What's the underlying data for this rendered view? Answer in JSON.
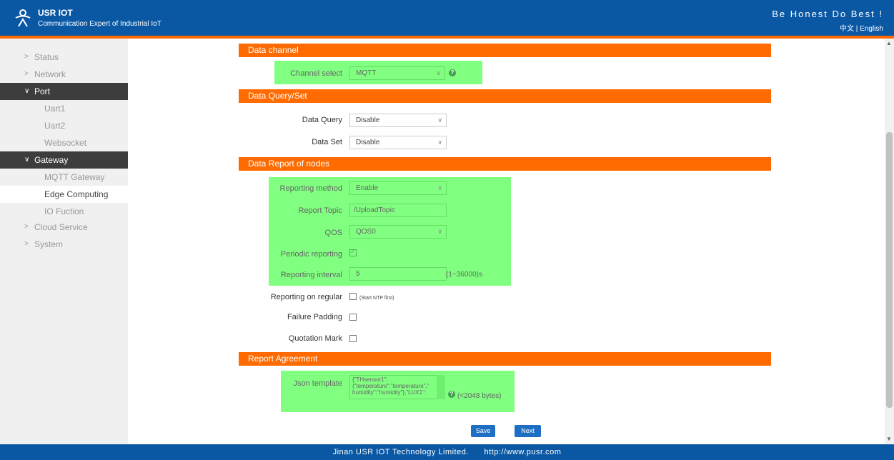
{
  "header": {
    "brand": "USR IOT",
    "tagline": "Communication Expert of Industrial IoT",
    "motto": "Be Honest Do Best !",
    "lang_cn": "中文",
    "lang_sep": "|",
    "lang_en": "English"
  },
  "sidebar": {
    "status": "Status",
    "network": "Network",
    "port": "Port",
    "uart1": "Uart1",
    "uart2": "Uart2",
    "websocket": "Websocket",
    "gateway": "Gateway",
    "mqtt_gateway": "MQTT Gateway",
    "edge_computing": "Edge Computing",
    "io_fuction": "IO Fuction",
    "cloud_service": "Cloud Service",
    "system": "System"
  },
  "sections": {
    "data_channel": "Data channel",
    "data_query_set": "Data Query/Set",
    "data_report": "Data Report of nodes",
    "report_agreement": "Report Agreement"
  },
  "form": {
    "channel_select_label": "Channel select",
    "channel_select_value": "MQTT",
    "data_query_label": "Data Query",
    "data_query_value": "Disable",
    "data_set_label": "Data Set",
    "data_set_value": "Disable",
    "reporting_method_label": "Reporting method",
    "reporting_method_value": "Enable",
    "report_topic_label": "Report Topic",
    "report_topic_value": "/UploadTopic",
    "qos_label": "QOS",
    "qos_value": "QOS0",
    "periodic_reporting_label": "Periodic reporting",
    "periodic_reporting_checked": true,
    "reporting_interval_label": "Reporting interval",
    "reporting_interval_value": "5",
    "reporting_interval_range": "(1~36000)s",
    "reporting_regular_label": "Reporting on regular",
    "reporting_regular_note": "(Start NTP first)",
    "failure_padding_label": "Failure Padding",
    "quotation_mark_label": "Quotation Mark",
    "json_template_label": "Json template",
    "json_template_value": "{\"THsensor1\":\n{\"temperature\":\"temperature\",\"\nhumidity\":\"humidity\"},\"LUX1\":",
    "json_template_limit": "(<2048 bytes)"
  },
  "buttons": {
    "save": "Save",
    "next": "Next"
  },
  "footer": {
    "company": "Jinan USR IOT Technology Limited.",
    "url": "http://www.pusr.com"
  },
  "colors": {
    "header_blue": "#0a58a4",
    "accent_orange": "#ff6b00",
    "highlight_green": "#80ff80"
  }
}
